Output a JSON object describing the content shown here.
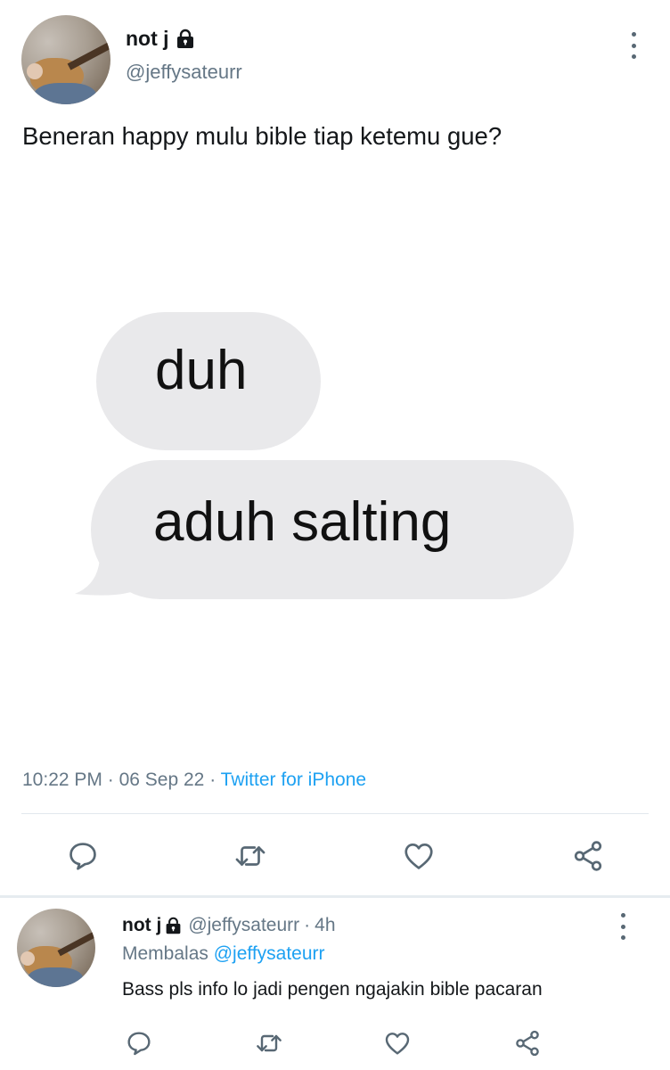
{
  "tweet": {
    "display_name": "not j",
    "handle": "@jeffysateurr",
    "text": "Beneran happy mulu bible tiap ketemu gue?",
    "media": {
      "bubble_1": "duh",
      "bubble_2": "aduh salting"
    },
    "time": "10:22 PM",
    "date": "06 Sep 22",
    "separator": "·",
    "source": "Twitter for iPhone"
  },
  "reply": {
    "display_name": "not j",
    "handle": "@jeffysateurr",
    "age": "4h",
    "separator": "·",
    "replying_prefix": "Membalas",
    "replying_to": "@jeffysateurr",
    "text": "Bass pls info lo jadi pengen ngajakin bible pacaran"
  },
  "icons": {
    "lock": "lock-icon",
    "more": "more-vertical-icon",
    "reply": "comment-icon",
    "retweet": "retweet-icon",
    "like": "heart-icon",
    "share": "share-icon"
  },
  "colors": {
    "accent": "#1da1f2",
    "secondary_text": "#657786",
    "bubble": "#e9e9eb",
    "icon": "#586874"
  }
}
